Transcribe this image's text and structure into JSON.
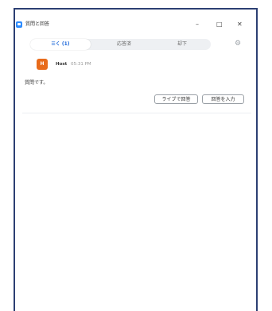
{
  "window": {
    "title": "質問と回答",
    "minimize_glyph": "–",
    "maximize_glyph": "□",
    "close_glyph": "✕"
  },
  "tabs": [
    {
      "label": "☰く (1)",
      "active": true
    },
    {
      "label": "応答済",
      "active": false
    },
    {
      "label": "却下",
      "active": false
    }
  ],
  "settings_icon": "gear-icon",
  "question": {
    "avatar_initial": "H",
    "avatar_color": "#e86b1b",
    "author": "Host",
    "time": "05:31 PM",
    "text": "質問です。",
    "actions": {
      "answer_live": "ライブで回答",
      "type_answer": "回答を入力"
    }
  },
  "colors": {
    "frame": "#2c3f73",
    "accent": "#1a66d9"
  }
}
